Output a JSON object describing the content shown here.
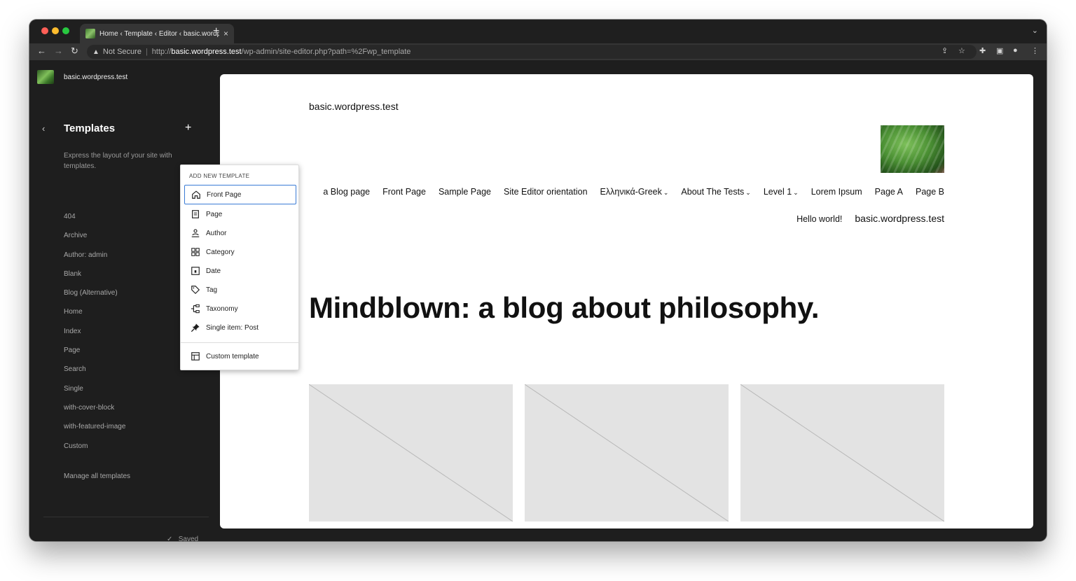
{
  "browser": {
    "tab_title": "Home ‹ Template ‹ Editor ‹ basic.wordpress.test",
    "tab_close": "×",
    "new_tab": "+",
    "security_label": "Not Secure",
    "url_scheme": "http://",
    "url_host": "basic.wordpress.test",
    "url_path": "/wp-admin/site-editor.php?path=%2Fwp_template"
  },
  "sidebar": {
    "site_name": "basic.wordpress.test",
    "title": "Templates",
    "add_label": "+",
    "description": "Express the layout of your site with templates.",
    "templates": [
      "404",
      "Archive",
      "Author: admin",
      "Blank",
      "Blog (Alternative)",
      "Home",
      "Index",
      "Page",
      "Search",
      "Single",
      "with-cover-block",
      "with-featured-image",
      "Custom"
    ],
    "manage_label": "Manage all templates",
    "saved_label": "Saved"
  },
  "dropdown": {
    "header": "ADD NEW TEMPLATE",
    "items": [
      {
        "label": "Front Page",
        "icon": "home-icon"
      },
      {
        "label": "Page",
        "icon": "page-icon"
      },
      {
        "label": "Author",
        "icon": "author-icon"
      },
      {
        "label": "Category",
        "icon": "category-icon"
      },
      {
        "label": "Date",
        "icon": "date-icon"
      },
      {
        "label": "Tag",
        "icon": "tag-icon"
      },
      {
        "label": "Taxonomy",
        "icon": "taxonomy-icon"
      },
      {
        "label": "Single item: Post",
        "icon": "pin-icon"
      }
    ],
    "custom_label": "Custom template"
  },
  "preview": {
    "site_title": "basic.wordpress.test",
    "nav": [
      "a Blog page",
      "Front Page",
      "Sample Page",
      "Site Editor orientation",
      "Ελληνικά-Greek",
      "About The Tests",
      "Level 1",
      "Lorem Ipsum",
      "Page A",
      "Page B"
    ],
    "sub_nav_1": "Hello world!",
    "sub_nav_2": "basic.wordpress.test",
    "heading": "Mindblown: a blog about philosophy."
  },
  "colors": {
    "focus": "#3a7bd5",
    "sidebar_bg": "#1e1e1e",
    "placeholder": "#e3e3e3"
  }
}
